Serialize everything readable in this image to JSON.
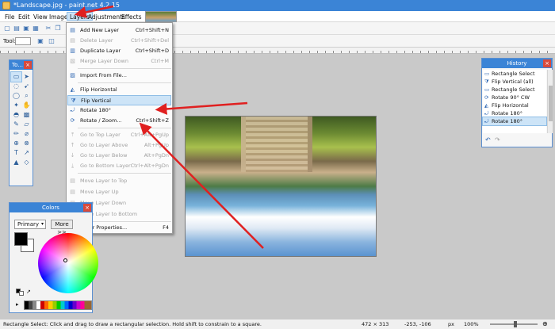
{
  "window": {
    "title": "*Landscape.jpg - paint.net 4.2.15"
  },
  "menubar": [
    "File",
    "Edit",
    "View",
    "Image",
    "Layers",
    "Adjustments",
    "Effects"
  ],
  "toolbar": {
    "tool_label": "Tool:"
  },
  "layers_menu": {
    "items": [
      {
        "label": "Add New Layer",
        "shortcut": "Ctrl+Shift+N",
        "icon": "add-layer-icon",
        "enabled": true
      },
      {
        "label": "Delete Layer",
        "shortcut": "Ctrl+Shift+Del",
        "icon": "delete-layer-icon",
        "enabled": false
      },
      {
        "label": "Duplicate Layer",
        "shortcut": "Ctrl+Shift+D",
        "icon": "duplicate-layer-icon",
        "enabled": true
      },
      {
        "label": "Merge Layer Down",
        "shortcut": "Ctrl+M",
        "icon": "merge-layer-icon",
        "enabled": false
      },
      {
        "label": "Import From File...",
        "shortcut": "",
        "icon": "import-file-icon",
        "enabled": true
      },
      {
        "label": "Flip Horizontal",
        "shortcut": "",
        "icon": "flip-horizontal-icon",
        "enabled": true
      },
      {
        "label": "Flip Vertical",
        "shortcut": "",
        "icon": "flip-vertical-icon",
        "enabled": true
      },
      {
        "label": "Rotate 180°",
        "shortcut": "",
        "icon": "rotate-180-icon",
        "enabled": true
      },
      {
        "label": "Rotate / Zoom...",
        "shortcut": "Ctrl+Shift+Z",
        "icon": "rotate-zoom-icon",
        "enabled": true
      },
      {
        "label": "Go to Top Layer",
        "shortcut": "Ctrl+Alt+PgUp",
        "icon": "go-top-icon",
        "enabled": false
      },
      {
        "label": "Go to Layer Above",
        "shortcut": "Alt+PgUp",
        "icon": "go-above-icon",
        "enabled": false
      },
      {
        "label": "Go to Layer Below",
        "shortcut": "Alt+PgDn",
        "icon": "go-below-icon",
        "enabled": false
      },
      {
        "label": "Go to Bottom Layer",
        "shortcut": "Ctrl+Alt+PgDn",
        "icon": "go-bottom-icon",
        "enabled": false
      },
      {
        "label": "Move Layer to Top",
        "shortcut": "",
        "icon": "move-top-icon",
        "enabled": false
      },
      {
        "label": "Move Layer Up",
        "shortcut": "",
        "icon": "move-up-icon",
        "enabled": false
      },
      {
        "label": "Move Layer Down",
        "shortcut": "",
        "icon": "move-down-icon",
        "enabled": false
      },
      {
        "label": "Move Layer to Bottom",
        "shortcut": "",
        "icon": "move-bottom-icon",
        "enabled": false
      },
      {
        "label": "Layer Properties...",
        "shortcut": "F4",
        "icon": "layer-properties-icon",
        "enabled": true
      }
    ]
  },
  "tools_panel": {
    "title": "To..."
  },
  "colors_panel": {
    "title": "Colors",
    "mode": "Primary",
    "more_label": "More >>",
    "primary_color": "#000000",
    "secondary_color": "#ffffff"
  },
  "history_panel": {
    "title": "History",
    "items": [
      "Rectangle Select",
      "Flip Vertical (all)",
      "Rectangle Select",
      "Rotate 90° CW",
      "Flip Horizontal",
      "Rotate 180°",
      "Rotate 180°"
    ]
  },
  "status": {
    "text": "Rectangle Select: Click and drag to draw a rectangular selection. Hold shift to constrain to a square.",
    "size": "472 × 313",
    "coords": "-253, -106",
    "unit": "px",
    "zoom": "100%"
  },
  "colors": {
    "accent": "#3b84d6",
    "annotation": "#e02020",
    "highlight": "#cde4f7"
  }
}
